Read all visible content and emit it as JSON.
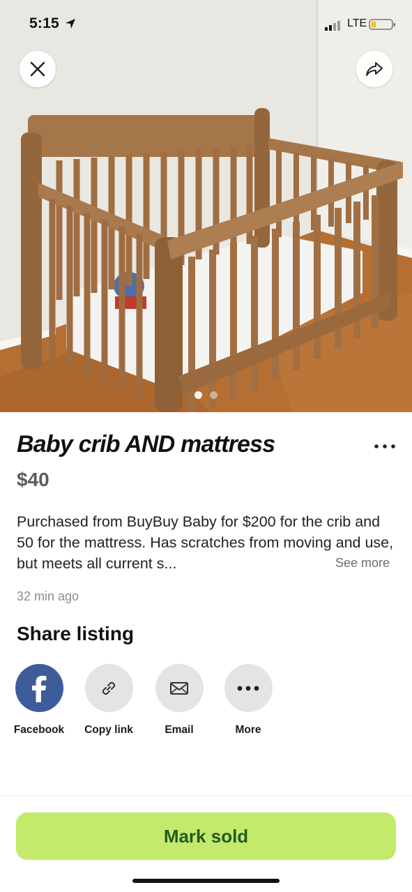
{
  "status_bar": {
    "time": "5:15",
    "network": "LTE",
    "icons": [
      "location-arrow-icon",
      "signal-bars-icon",
      "battery-icon"
    ]
  },
  "photo": {
    "alt_subject": "wooden crib",
    "page_indicator": {
      "current": 1,
      "total": 2
    },
    "buttons": {
      "close_icon": "close-icon",
      "share_icon": "share-arrow-icon"
    }
  },
  "listing": {
    "title": "Baby crib AND mattress",
    "price": "$40",
    "description": "Purchased from BuyBuy Baby for $200 for the crib and 50 for the mattress. Has scratches from moving and use, but meets all current s...",
    "see_more_label": "See more",
    "posted": "32 min ago",
    "menu_icon": "more-horizontal-icon"
  },
  "share": {
    "heading": "Share listing",
    "options": [
      {
        "label": "Facebook",
        "icon": "facebook-icon"
      },
      {
        "label": "Copy link",
        "icon": "link-icon"
      },
      {
        "label": "Email",
        "icon": "envelope-icon"
      },
      {
        "label": "More",
        "icon": "more-horizontal-icon"
      }
    ]
  },
  "footer": {
    "mark_sold_label": "Mark sold"
  },
  "colors": {
    "mark_sold_bg": "#c4ea6c",
    "mark_sold_text": "#245a23",
    "facebook": "#3e5c99",
    "share_circle": "#e4e4e4",
    "price": "#5c5c5c"
  }
}
